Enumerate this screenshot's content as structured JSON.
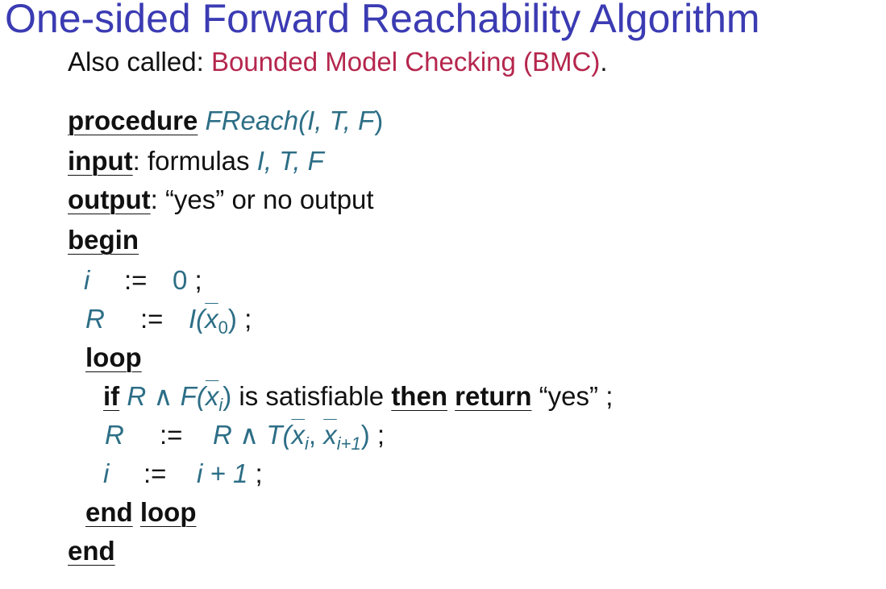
{
  "title": "One-sided Forward Reachability Algorithm",
  "subtitle": {
    "prefix": "Also called: ",
    "accent": "Bounded Model Checking (BMC)",
    "suffix": "."
  },
  "colors": {
    "title": "#3b3bb3",
    "accent": "#b5264d",
    "math": "#2d6e86"
  },
  "procedure": {
    "header_kw": "procedure",
    "header_name": "FReach(",
    "header_args": "I, T, F",
    "header_close": ")",
    "input_kw": "input",
    "input_text": ": formulas ",
    "input_args": "I, T, F",
    "output_kw": "output",
    "output_text": ": “yes” or no output",
    "begin_kw": "begin",
    "line_i_var": "i",
    "line_i_assign": ":=",
    "line_i_val": "0",
    "semicolon": ";",
    "line_r_var": "R",
    "line_r_assign": ":=",
    "line_r_expr_pre": "I(",
    "line_r_x": "x",
    "line_r_sub": "0",
    "line_r_expr_post": ")",
    "loop_kw": "loop",
    "if_kw": "if",
    "if_expr_pre": "R ∧ F(",
    "if_x": "x",
    "if_sub": "i",
    "if_expr_post": ")",
    "if_text": " is satisfiable ",
    "then_kw": "then",
    "return_kw": "return",
    "return_val": "“yes”",
    "r2_var": "R",
    "r2_assign": ":=",
    "r2_expr_pre": "R ∧ T(",
    "r2_x1": "x",
    "r2_sub1": "i",
    "r2_comma": ", ",
    "r2_x2": "x",
    "r2_sub2": "i+1",
    "r2_expr_post": ")",
    "inc_var": "i",
    "inc_assign": ":=",
    "inc_expr": "i + 1",
    "end_kw": "end",
    "end_loop_kw": "loop",
    "end_final_kw": "end"
  }
}
